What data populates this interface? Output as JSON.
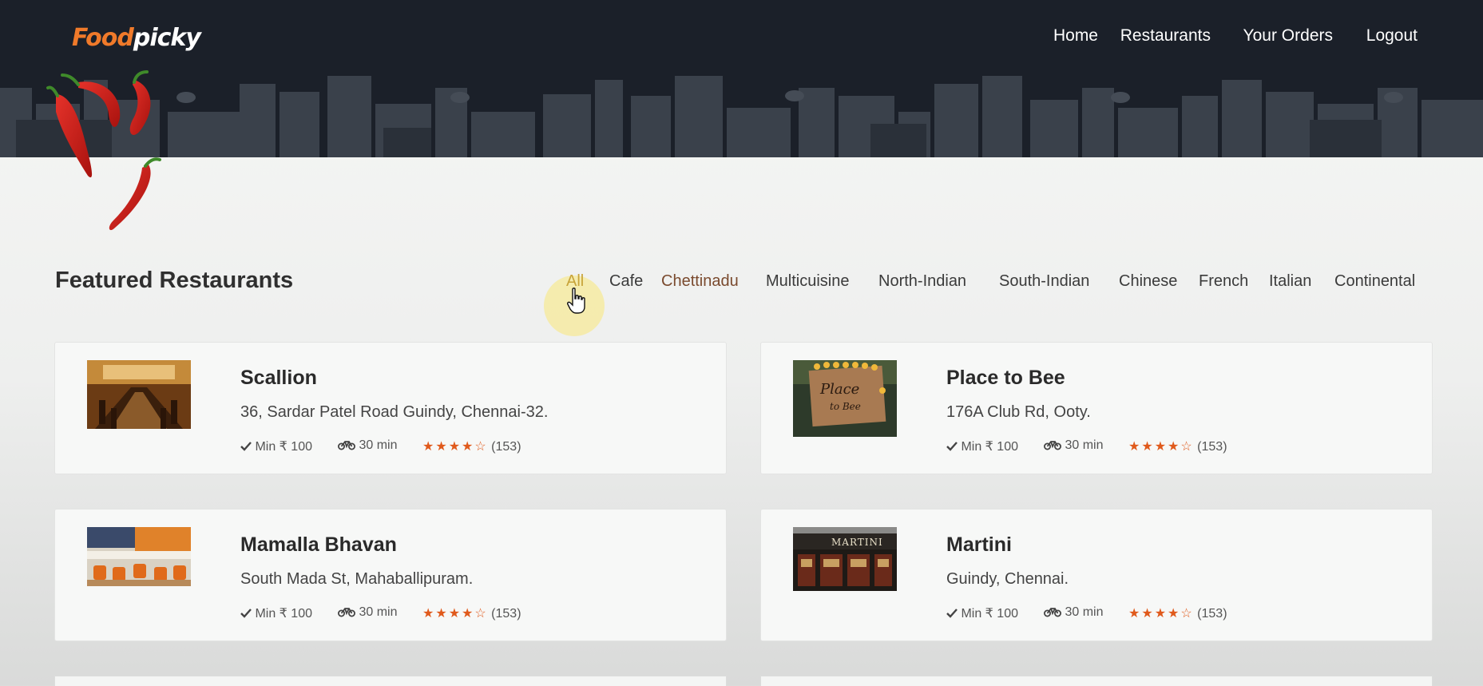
{
  "brand": {
    "part1": "Food",
    "part2": "picky"
  },
  "nav": {
    "home": "Home",
    "restaurants": "Restaurants",
    "orders": "Your Orders",
    "logout": "Logout"
  },
  "featured": {
    "title": "Featured Restaurants",
    "filters": [
      "All",
      "Cafe",
      "Chettinadu",
      "Multicuisine",
      "North-Indian",
      "South-Indian",
      "Chinese",
      "French",
      "Italian",
      "Continental"
    ],
    "active_filter": "All"
  },
  "restaurants": [
    {
      "name": "Scallion",
      "address": "36, Sardar Patel Road Guindy, Chennai-32.",
      "min": "Min ₹ 100",
      "time": "30 min",
      "rating": 4,
      "reviews": "(153)"
    },
    {
      "name": "Place to Bee",
      "address": "176A Club Rd, Ooty.",
      "min": "Min ₹ 100",
      "time": "30 min",
      "rating": 4,
      "reviews": "(153)",
      "sign_text_1": "Place",
      "sign_text_2": "to Bee"
    },
    {
      "name": "Mamalla Bhavan",
      "address": "South Mada St, Mahaballipuram.",
      "min": "Min ₹ 100",
      "time": "30 min",
      "rating": 4,
      "reviews": "(153)"
    },
    {
      "name": "Martini",
      "address": "Guindy, Chennai.",
      "min": "Min ₹ 100",
      "time": "30 min",
      "rating": 4,
      "reviews": "(153)",
      "sign_text": "MARTINI"
    }
  ],
  "colors": {
    "header_bg": "#1a1f28",
    "accent_orange": "#f07a2a",
    "star": "#e05a1c",
    "active_filter": "#c8a43a"
  },
  "icons": {
    "min_order": "check-icon",
    "delivery": "bike-icon",
    "rating": "star-icon",
    "cursor": "hand-pointer-icon"
  }
}
